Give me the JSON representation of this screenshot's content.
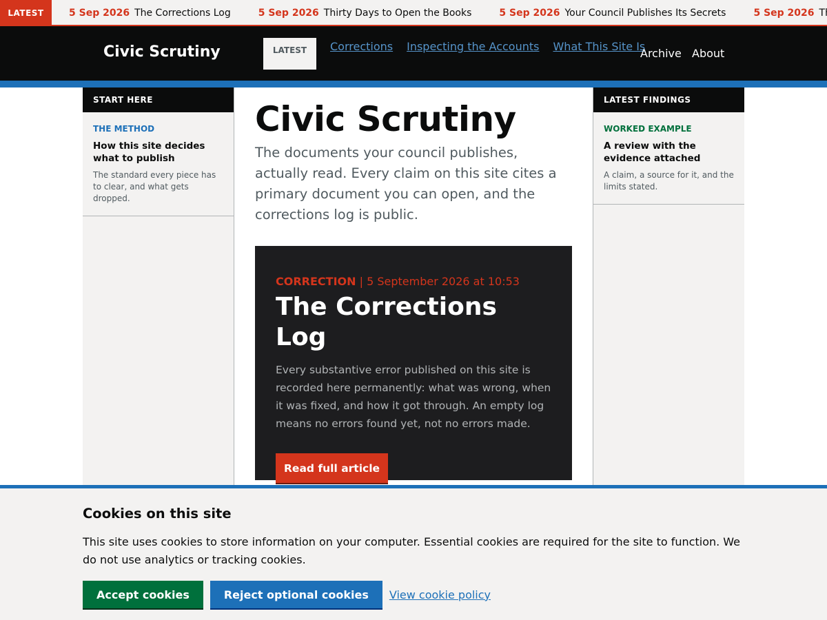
{
  "ticker": {
    "badge": "LATEST",
    "items": [
      {
        "date": "5 Sep 2026",
        "title": "The Corrections Log"
      },
      {
        "date": "5 Sep 2026",
        "title": "Thirty Days to Open the Books"
      },
      {
        "date": "5 Sep 2026",
        "title": "Your Council Publishes Its Secrets"
      },
      {
        "date": "5 Sep 2026",
        "title": "The Corrections Log"
      }
    ]
  },
  "header": {
    "brand": "Civic Scrutiny",
    "latest_label": "LATEST",
    "nav_links": [
      "Corrections",
      "Inspecting the Accounts",
      "What This Site Is"
    ],
    "archive": "Archive",
    "about": "About"
  },
  "left_sidebar": {
    "heading": "START HERE",
    "card": {
      "tag": "THE METHOD",
      "tag_color": "#1d70b8",
      "title": "How this site decides what to publish",
      "description": "The standard every piece has to clear, and what gets dropped."
    }
  },
  "right_sidebar": {
    "heading": "LATEST FINDINGS",
    "card": {
      "tag": "WORKED EXAMPLE",
      "tag_color": "#00703c",
      "title": "A review with the evidence attached",
      "description": "A claim, a source for it, and the limits stated."
    }
  },
  "main": {
    "title": "Civic Scrutiny",
    "lede": "The documents your council publishes, actually read. Every claim on this site cites a primary document you can open, and the corrections log is public.",
    "feature": {
      "kind": "CORRECTION",
      "separator": " | ",
      "timestamp": "5 September 2026 at 10:53",
      "title": "The Corrections Log",
      "body": "Every substantive error published on this site is recorded here permanently: what was wrong, when it was fixed, and how it got through. An empty log means no errors found yet, not no errors made.",
      "button": "Read full article"
    }
  },
  "cookie_banner": {
    "title": "Cookies on this site",
    "text": "This site uses cookies to store information on your computer. Essential cookies are required for the site to function. We do not use analytics or tracking cookies.",
    "accept": "Accept cookies",
    "reject": "Reject optional cookies",
    "policy_link": "View cookie policy"
  },
  "colors": {
    "accent_red": "#d4351c",
    "accent_blue": "#1d70b8",
    "accent_green": "#00703c",
    "header_bg": "#0b0c0c",
    "feature_bg": "#1d1d1f"
  }
}
